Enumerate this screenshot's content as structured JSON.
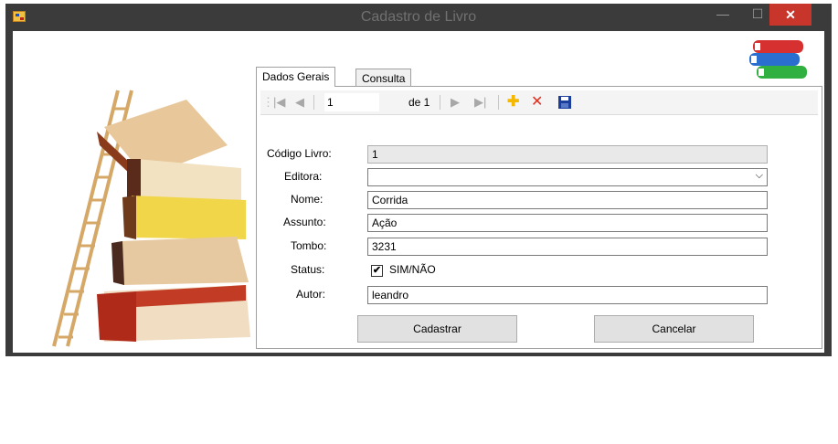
{
  "window": {
    "title": "Cadastro de Livro",
    "close_symbol": "✕",
    "minimize_symbol": "—",
    "maximize_symbol": "☐"
  },
  "tabs": [
    {
      "label": "Dados Gerais",
      "active": true
    },
    {
      "label": "Consulta",
      "active": false
    }
  ],
  "navigator": {
    "position": "1",
    "count_label": "de 1",
    "icons": [
      "move-first-icon",
      "move-previous-icon",
      "move-next-icon",
      "move-last-icon",
      "add-new-icon",
      "delete-icon",
      "save-icon"
    ]
  },
  "form": {
    "codigo": {
      "label": "Código Livro:",
      "value": "1"
    },
    "editora": {
      "label": "Editora:",
      "value": ""
    },
    "nome": {
      "label": "Nome:",
      "value": "Corrida"
    },
    "assunto": {
      "label": "Assunto:",
      "value": "Ação"
    },
    "tombo": {
      "label": "Tombo:",
      "value": "3231"
    },
    "status": {
      "label": "Status:",
      "checkbox_label": "SIM/NÃO",
      "checked": true
    },
    "autor": {
      "label": "Autor:",
      "value": "leandro"
    }
  },
  "buttons": {
    "cadastrar": "Cadastrar",
    "cancelar": "Cancelar"
  },
  "colors": {
    "titlebar": "#3b3b3b",
    "close_button": "#c7352b",
    "add_icon": "#f5b800",
    "delete_icon": "#e03020",
    "save_icon": "#1c3f9e"
  }
}
